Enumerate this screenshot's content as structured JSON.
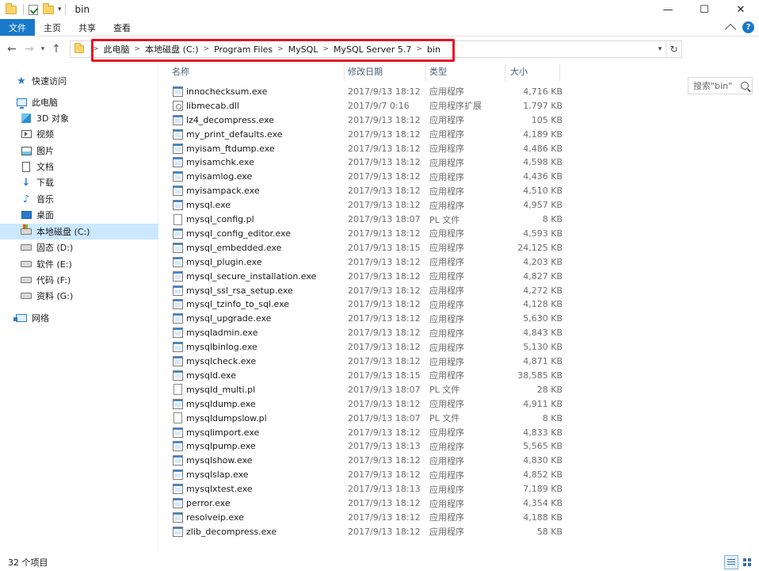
{
  "window": {
    "title": "bin",
    "minimize": "—",
    "maximize": "☐",
    "close": "✕"
  },
  "ribbon": {
    "tabs": [
      "文件",
      "主页",
      "共享",
      "查看"
    ]
  },
  "address": {
    "crumbs": [
      "此电脑",
      "本地磁盘 (C:)",
      "Program Files",
      "MySQL",
      "MySQL Server 5.7",
      "bin"
    ],
    "highlight_color": "#e81123"
  },
  "search": {
    "placeholder": "搜索\"bin\""
  },
  "sidebar": {
    "quick_access": "快速访问",
    "this_pc": "此电脑",
    "items": [
      "3D 对象",
      "视频",
      "图片",
      "文档",
      "下载",
      "音乐",
      "桌面"
    ],
    "drives": [
      "本地磁盘 (C:)",
      "固态 (D:)",
      "软件 (E:)",
      "代码 (F:)",
      "资料 (G:)"
    ],
    "network": "网络"
  },
  "columns": {
    "name": "名称",
    "date": "修改日期",
    "type": "类型",
    "size": "大小"
  },
  "files": [
    {
      "name": "innochecksum.exe",
      "date": "2017/9/13 18:12",
      "type": "应用程序",
      "size": "4,716 KB",
      "kind": "exe"
    },
    {
      "name": "libmecab.dll",
      "date": "2017/9/7 0:16",
      "type": "应用程序扩展",
      "size": "1,797 KB",
      "kind": "dll"
    },
    {
      "name": "lz4_decompress.exe",
      "date": "2017/9/13 18:12",
      "type": "应用程序",
      "size": "105 KB",
      "kind": "exe"
    },
    {
      "name": "my_print_defaults.exe",
      "date": "2017/9/13 18:12",
      "type": "应用程序",
      "size": "4,189 KB",
      "kind": "exe"
    },
    {
      "name": "myisam_ftdump.exe",
      "date": "2017/9/13 18:12",
      "type": "应用程序",
      "size": "4,486 KB",
      "kind": "exe"
    },
    {
      "name": "myisamchk.exe",
      "date": "2017/9/13 18:12",
      "type": "应用程序",
      "size": "4,598 KB",
      "kind": "exe"
    },
    {
      "name": "myisamlog.exe",
      "date": "2017/9/13 18:12",
      "type": "应用程序",
      "size": "4,436 KB",
      "kind": "exe"
    },
    {
      "name": "myisampack.exe",
      "date": "2017/9/13 18:12",
      "type": "应用程序",
      "size": "4,510 KB",
      "kind": "exe"
    },
    {
      "name": "mysql.exe",
      "date": "2017/9/13 18:12",
      "type": "应用程序",
      "size": "4,957 KB",
      "kind": "exe"
    },
    {
      "name": "mysql_config.pl",
      "date": "2017/9/13 18:07",
      "type": "PL 文件",
      "size": "8 KB",
      "kind": "pl"
    },
    {
      "name": "mysql_config_editor.exe",
      "date": "2017/9/13 18:12",
      "type": "应用程序",
      "size": "4,593 KB",
      "kind": "exe"
    },
    {
      "name": "mysql_embedded.exe",
      "date": "2017/9/13 18:15",
      "type": "应用程序",
      "size": "24,125 KB",
      "kind": "exe"
    },
    {
      "name": "mysql_plugin.exe",
      "date": "2017/9/13 18:12",
      "type": "应用程序",
      "size": "4,203 KB",
      "kind": "exe"
    },
    {
      "name": "mysql_secure_installation.exe",
      "date": "2017/9/13 18:12",
      "type": "应用程序",
      "size": "4,827 KB",
      "kind": "exe"
    },
    {
      "name": "mysql_ssl_rsa_setup.exe",
      "date": "2017/9/13 18:12",
      "type": "应用程序",
      "size": "4,272 KB",
      "kind": "exe"
    },
    {
      "name": "mysql_tzinfo_to_sql.exe",
      "date": "2017/9/13 18:12",
      "type": "应用程序",
      "size": "4,128 KB",
      "kind": "exe"
    },
    {
      "name": "mysql_upgrade.exe",
      "date": "2017/9/13 18:12",
      "type": "应用程序",
      "size": "5,630 KB",
      "kind": "exe"
    },
    {
      "name": "mysqladmin.exe",
      "date": "2017/9/13 18:12",
      "type": "应用程序",
      "size": "4,843 KB",
      "kind": "exe"
    },
    {
      "name": "mysqlbinlog.exe",
      "date": "2017/9/13 18:12",
      "type": "应用程序",
      "size": "5,130 KB",
      "kind": "exe"
    },
    {
      "name": "mysqlcheck.exe",
      "date": "2017/9/13 18:12",
      "type": "应用程序",
      "size": "4,871 KB",
      "kind": "exe"
    },
    {
      "name": "mysqld.exe",
      "date": "2017/9/13 18:15",
      "type": "应用程序",
      "size": "38,585 KB",
      "kind": "exe"
    },
    {
      "name": "mysqld_multi.pl",
      "date": "2017/9/13 18:07",
      "type": "PL 文件",
      "size": "28 KB",
      "kind": "pl"
    },
    {
      "name": "mysqldump.exe",
      "date": "2017/9/13 18:12",
      "type": "应用程序",
      "size": "4,911 KB",
      "kind": "exe"
    },
    {
      "name": "mysqldumpslow.pl",
      "date": "2017/9/13 18:07",
      "type": "PL 文件",
      "size": "8 KB",
      "kind": "pl"
    },
    {
      "name": "mysqlimport.exe",
      "date": "2017/9/13 18:12",
      "type": "应用程序",
      "size": "4,833 KB",
      "kind": "exe"
    },
    {
      "name": "mysqlpump.exe",
      "date": "2017/9/13 18:13",
      "type": "应用程序",
      "size": "5,565 KB",
      "kind": "exe"
    },
    {
      "name": "mysqlshow.exe",
      "date": "2017/9/13 18:12",
      "type": "应用程序",
      "size": "4,830 KB",
      "kind": "exe"
    },
    {
      "name": "mysqlslap.exe",
      "date": "2017/9/13 18:12",
      "type": "应用程序",
      "size": "4,852 KB",
      "kind": "exe"
    },
    {
      "name": "mysqlxtest.exe",
      "date": "2017/9/13 18:13",
      "type": "应用程序",
      "size": "7,189 KB",
      "kind": "exe"
    },
    {
      "name": "perror.exe",
      "date": "2017/9/13 18:12",
      "type": "应用程序",
      "size": "4,354 KB",
      "kind": "exe"
    },
    {
      "name": "resolveip.exe",
      "date": "2017/9/13 18:12",
      "type": "应用程序",
      "size": "4,188 KB",
      "kind": "exe"
    },
    {
      "name": "zlib_decompress.exe",
      "date": "2017/9/13 18:12",
      "type": "应用程序",
      "size": "58 KB",
      "kind": "exe"
    }
  ],
  "status": {
    "item_count": "32 个项目"
  }
}
